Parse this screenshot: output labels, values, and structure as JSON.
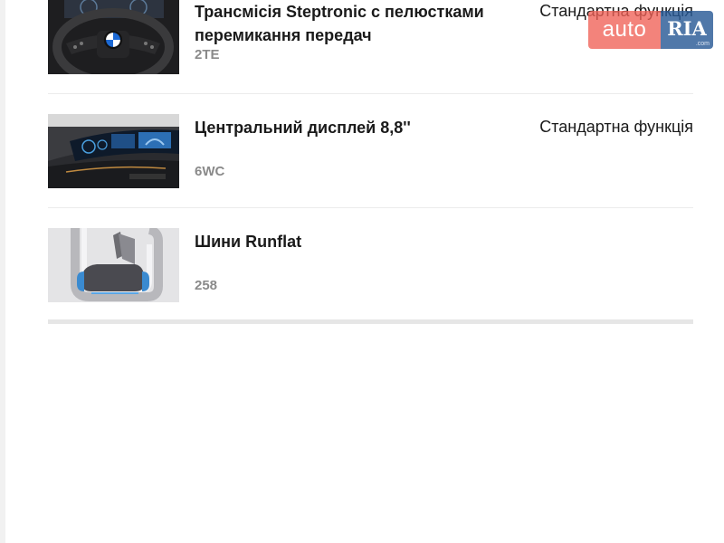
{
  "features": [
    {
      "title": "Трансмісія Steptronic с пелюстками перемикання передач",
      "code": "2TE",
      "status": "Стандартна функція",
      "image": "steering-wheel-image"
    },
    {
      "title": "Центральний дисплей 8,8''",
      "code": "6WC",
      "status": "Стандартна функція",
      "image": "central-display-image"
    },
    {
      "title": "Шини Runflat",
      "code": "258",
      "status": "",
      "image": "runflat-tire-image"
    }
  ],
  "watermark": {
    "brand_left": "auto",
    "brand_right": "RIA",
    "domain": ".com"
  },
  "colors": {
    "watermark_auto": "#f06056",
    "watermark_ria": "#2a5a96",
    "code_text": "#8a8a8a",
    "divider": "#ececec"
  }
}
